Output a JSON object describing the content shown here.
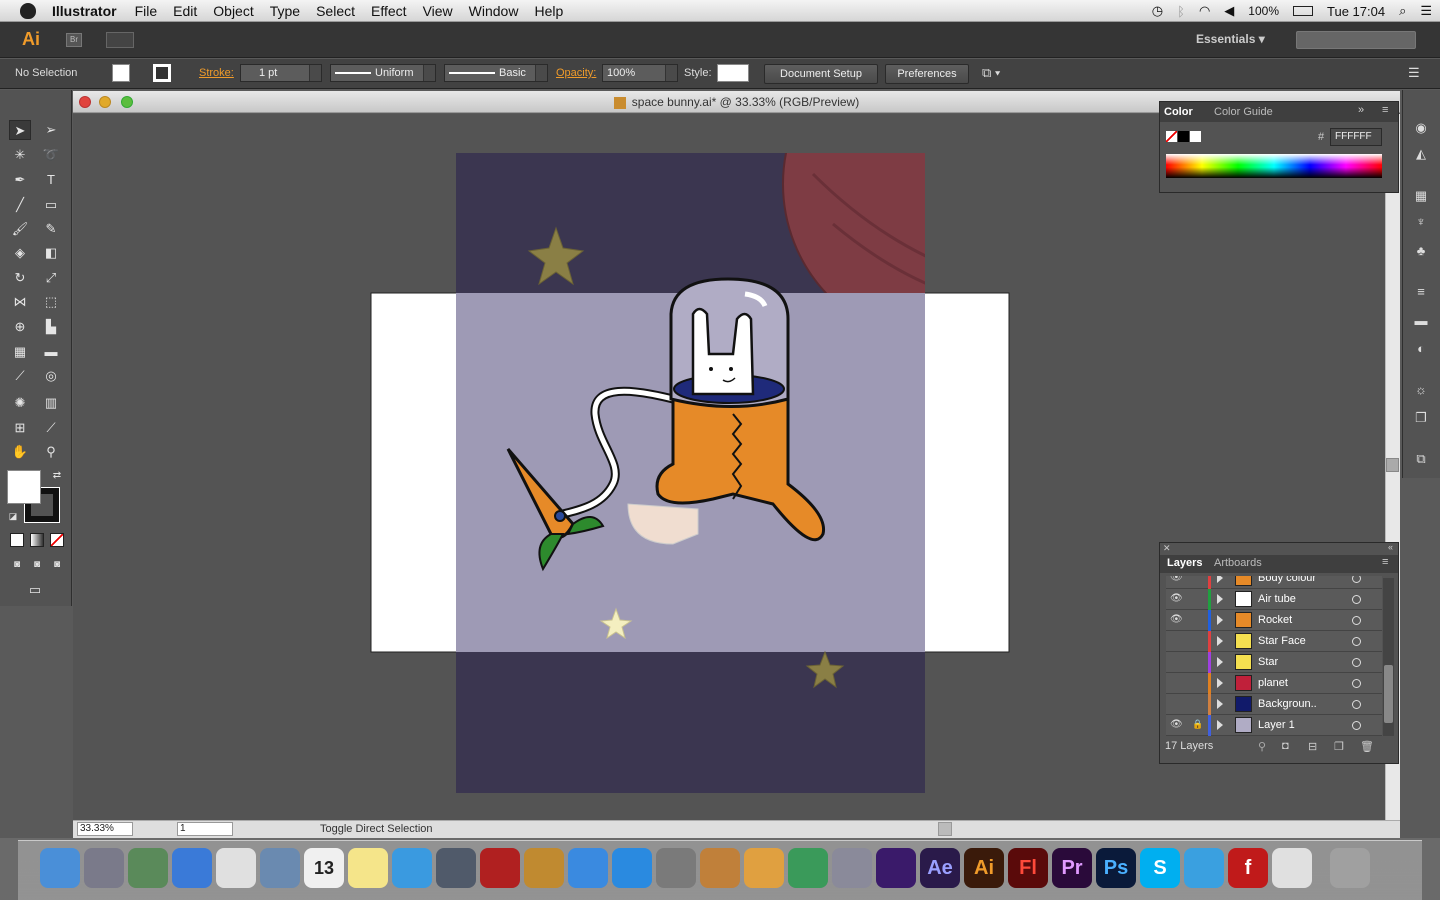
{
  "menubar": {
    "app_name": "Illustrator",
    "items": [
      "File",
      "Edit",
      "Object",
      "Type",
      "Select",
      "Effect",
      "View",
      "Window",
      "Help"
    ],
    "battery": "100%",
    "clock": "Tue 17:04"
  },
  "appbar": {
    "logo": "Ai",
    "bridge": "Br",
    "workspace": "Essentials"
  },
  "control": {
    "selection": "No Selection",
    "stroke_label": "Stroke:",
    "stroke_weight": "1 pt",
    "profile": "Uniform",
    "brush": "Basic",
    "opacity_label": "Opacity:",
    "opacity": "100%",
    "style_label": "Style:",
    "document_setup": "Document Setup",
    "preferences": "Preferences"
  },
  "document": {
    "title": "space bunny.ai* @ 33.33% (RGB/Preview)"
  },
  "status": {
    "zoom": "33.33%",
    "page": "1",
    "text": "Toggle Direct Selection"
  },
  "color_panel": {
    "tab_color": "Color",
    "tab_guide": "Color Guide",
    "hash": "#",
    "hex": "FFFFFF"
  },
  "layers_panel": {
    "tab_layers": "Layers",
    "tab_artboards": "Artboards",
    "count": "17 Layers",
    "rows": [
      {
        "name": "Body colour",
        "color": "#e04040",
        "visible": true
      },
      {
        "name": "Air tube",
        "color": "#20a040",
        "visible": true
      },
      {
        "name": "Rocket",
        "color": "#2060e0",
        "visible": true
      },
      {
        "name": "Star Face",
        "color": "#e04040",
        "visible": false
      },
      {
        "name": "Star",
        "color": "#a040e0",
        "visible": false
      },
      {
        "name": "planet",
        "color": "#e08020",
        "visible": false
      },
      {
        "name": "Backgroun..",
        "color": "#d08040",
        "visible": false
      },
      {
        "name": "Layer 1",
        "color": "#4060e0",
        "visible": true,
        "locked": true
      }
    ]
  },
  "dock": {
    "apps": [
      "Finder",
      "Launchpad",
      "Preview",
      "Safari",
      "Chrome",
      "Mail",
      "Calendar",
      "Stickies",
      "Messages",
      "FaceTime",
      "Photo Booth",
      "iPhoto",
      "iTunes",
      "App Store",
      "System Preferences",
      "GarageBand",
      "Keynote",
      "Numbers",
      "Script Editor",
      "Media Encoder",
      "Ae",
      "Ai",
      "Fl",
      "Pr",
      "Ps",
      "Skype",
      "Dashboard",
      "Flash",
      "Finder Window",
      "Trash"
    ],
    "calendar_day": "13"
  },
  "colors": {
    "accent": "#f09b2a",
    "space": "#3b3650",
    "space_overlay": "#9e9ab5",
    "planet": "#7e3c44",
    "suit": "#e68a28"
  }
}
